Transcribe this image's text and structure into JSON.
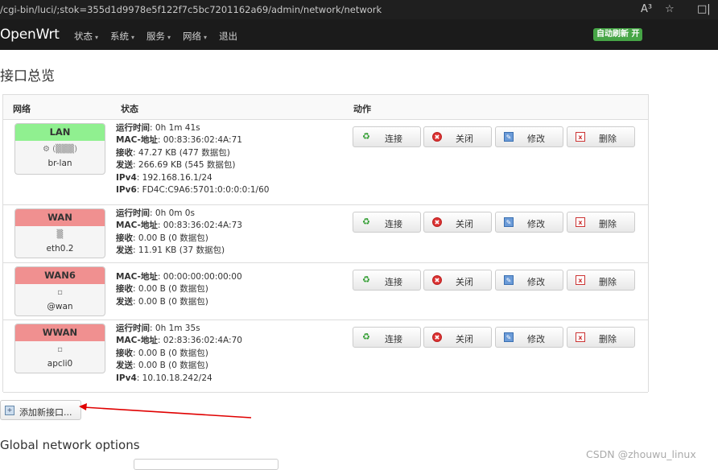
{
  "browser": {
    "url": "/cgi-bin/luci/;stok=355d1d9978e5f122f7c5bc7201162a69/admin/network/network",
    "read_aloud_icon": "A³",
    "favorite_icon": "☆",
    "split_icon": "□|"
  },
  "navbar": {
    "brand": "OpenWrt",
    "menu": [
      {
        "label": "状态",
        "caret": "▾"
      },
      {
        "label": "系统",
        "caret": "▾"
      },
      {
        "label": "服务",
        "caret": "▾"
      },
      {
        "label": "网络",
        "caret": "▾"
      },
      {
        "label": "退出",
        "caret": ""
      }
    ],
    "auto_refresh": "自动刷新 开"
  },
  "page_title": "接口总览",
  "table": {
    "headers": {
      "network": "网络",
      "status": "状态",
      "actions": "动作"
    },
    "button_labels": {
      "connect": "连接",
      "stop": "关闭",
      "edit": "修改",
      "delete": "删除"
    },
    "rows": [
      {
        "name": "LAN",
        "icon_text": "⚙ (▒▒▒)",
        "device": "br-lan",
        "status": [
          {
            "k": "运行时间",
            "v": "0h 1m 41s"
          },
          {
            "k": "MAC-地址",
            "v": "00:83:36:02:4A:71"
          },
          {
            "k": "接收",
            "v": "47.27 KB (477 数据包)"
          },
          {
            "k": "发送",
            "v": "266.69 KB (545 数据包)"
          },
          {
            "k": "IPv4",
            "v": "192.168.16.1/24"
          },
          {
            "k": "IPv6",
            "v": "FD4C:C9A6:5701:0:0:0:0:1/60"
          }
        ]
      },
      {
        "name": "WAN",
        "icon_text": "▒",
        "device": "eth0.2",
        "status": [
          {
            "k": "运行时间",
            "v": "0h 0m 0s"
          },
          {
            "k": "MAC-地址",
            "v": "00:83:36:02:4A:73"
          },
          {
            "k": "接收",
            "v": "0.00 B (0 数据包)"
          },
          {
            "k": "发送",
            "v": "11.91 KB (37 数据包)"
          }
        ]
      },
      {
        "name": "WAN6",
        "icon_text": "▫",
        "device": "@wan",
        "status": [
          {
            "k": "MAC-地址",
            "v": "00:00:00:00:00:00"
          },
          {
            "k": "接收",
            "v": "0.00 B (0 数据包)"
          },
          {
            "k": "发送",
            "v": "0.00 B (0 数据包)"
          }
        ]
      },
      {
        "name": "WWAN",
        "icon_text": "▫",
        "device": "apcli0",
        "status": [
          {
            "k": "运行时间",
            "v": "0h 1m 35s"
          },
          {
            "k": "MAC-地址",
            "v": "02:83:36:02:4A:70"
          },
          {
            "k": "接收",
            "v": "0.00 B (0 数据包)"
          },
          {
            "k": "发送",
            "v": "0.00 B (0 数据包)"
          },
          {
            "k": "IPv4",
            "v": "10.10.18.242/24"
          }
        ]
      }
    ]
  },
  "add_interface_label": "添加新接口...",
  "global_options_title": "Global network options",
  "watermark": "CSDN @zhouwu_linux",
  "colors": {
    "lan": "#90f090",
    "wan": "#f09090",
    "arrow": "#e00000",
    "refresh": "#46a546"
  }
}
